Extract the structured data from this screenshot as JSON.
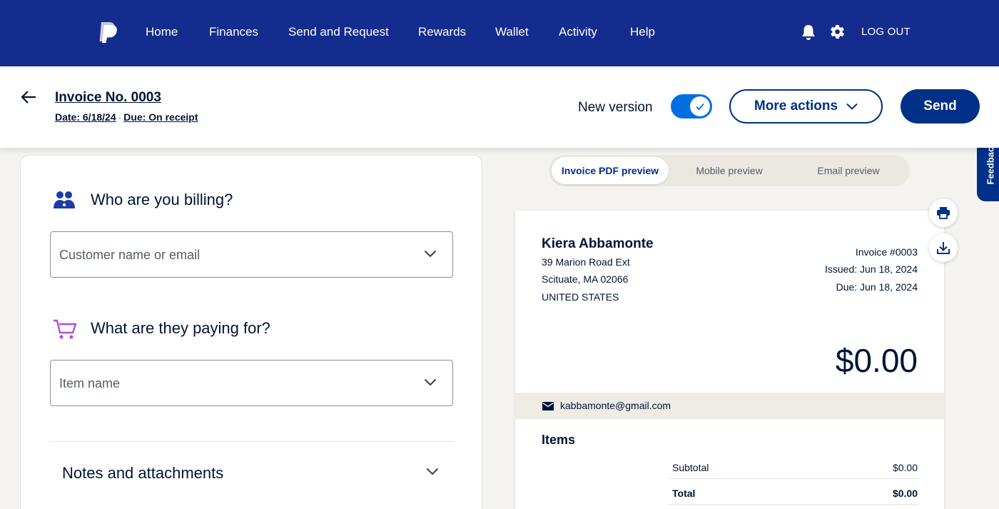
{
  "nav": {
    "links": [
      "Home",
      "Finances",
      "Send and Request",
      "Rewards",
      "Wallet",
      "Activity",
      "Help"
    ],
    "logout": "LOG OUT",
    "bg_color": "#142c8e"
  },
  "header": {
    "title": "Invoice No. 0003",
    "date": "Date: 6/18/24",
    "separator": "·",
    "due": "Due: On receipt",
    "new_version_label": "New version",
    "new_version_enabled": true,
    "more_actions": "More actions",
    "send": "Send"
  },
  "form": {
    "billing_title": "Who are you billing?",
    "customer_placeholder": "Customer name or email",
    "paying_title": "What are they paying for?",
    "item_placeholder": "Item name",
    "notes_title": "Notes and attachments"
  },
  "preview": {
    "tabs": [
      "Invoice PDF preview",
      "Mobile preview",
      "Email preview"
    ],
    "active_tab": "Invoice PDF preview"
  },
  "invoice": {
    "customer_name": "Kiera Abbamonte",
    "address_lines": [
      "39 Marion Road Ext",
      "Scituate, MA 02066",
      "UNITED STATES"
    ],
    "invoice_number": "Invoice #0003",
    "issued": "Issued: Jun 18, 2024",
    "due": "Due: Jun 18, 2024",
    "amount": "$0.00",
    "email": "kabbamonte@gmail.com",
    "items_heading": "Items",
    "subtotal_label": "Subtotal",
    "subtotal_value": "$0.00",
    "total_label": "Total",
    "total_value": "$0.00"
  },
  "feedback": "Feedback",
  "colors": {
    "primary": "#003087",
    "accent": "#0070e0"
  }
}
